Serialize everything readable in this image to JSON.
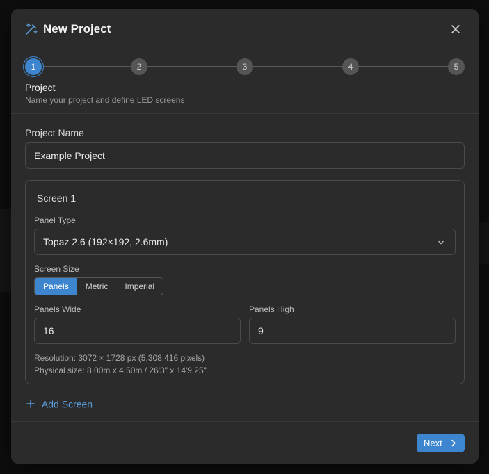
{
  "dialog": {
    "title": "New Project",
    "icon": "magic-wand-icon",
    "close_icon": "close-icon"
  },
  "stepper": {
    "steps": [
      "1",
      "2",
      "3",
      "4",
      "5"
    ],
    "current_step": 1,
    "current_title": "Project",
    "current_description": "Name your project and define LED screens"
  },
  "project": {
    "name_label": "Project Name",
    "name_value": "Example Project"
  },
  "screen": {
    "title": "Screen 1",
    "panel_type_label": "Panel Type",
    "panel_type_value": "Topaz 2.6 (192×192, 2.6mm)",
    "screen_size_label": "Screen Size",
    "size_modes": [
      "Panels",
      "Metric",
      "Imperial"
    ],
    "selected_size_mode": "Panels",
    "panels_wide_label": "Panels Wide",
    "panels_wide_value": "16",
    "panels_high_label": "Panels High",
    "panels_high_value": "9",
    "resolution_text": "Resolution: 3072 × 1728 px (5,308,416 pixels)",
    "physical_text": "Physical size: 8.00m x 4.50m / 26'3\" x 14'9.25\""
  },
  "actions": {
    "add_screen_label": "Add Screen",
    "next_label": "Next"
  },
  "colors": {
    "accent": "#3d86cf",
    "link": "#5b9fe0",
    "dialog_bg": "#2b2b2b"
  }
}
